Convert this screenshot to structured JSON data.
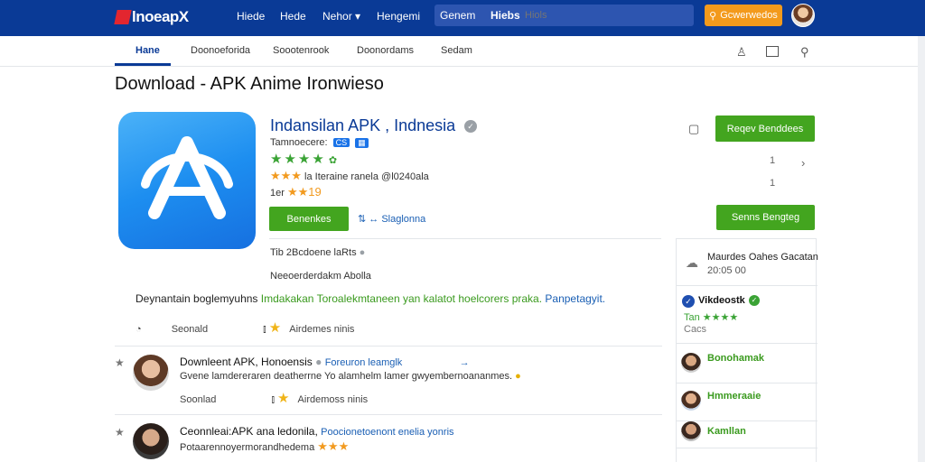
{
  "topbar": {
    "logo": "lnoeapX",
    "nav": [
      "Hiede",
      "Hede",
      "Nehor"
    ],
    "search_left": "Hengemi",
    "search_a": "Genem",
    "search_b": "Hiebs",
    "search_placeholder": "Hiols",
    "action_button": "Gcwerwedos"
  },
  "subnav": {
    "tabs": [
      "Hane",
      "Doonoeforida",
      "Soootenrook",
      "Doonordams",
      "Sedam"
    ]
  },
  "page_title": "Download - APK Anime Ironwieso",
  "app": {
    "name": "Indansilan APK , Indnesia",
    "developer": "Tamnoecere:",
    "developer_chip": "CS",
    "rating_stars": "★★★★",
    "rating_text": "la Iteraine ranela @l0240ala",
    "rating_prefix": "★★★",
    "size_label": "1er",
    "size_stars": "★★19",
    "download_button": "Benenkes",
    "share_label": "Slaglonna",
    "info_line": "Tib 2Bcdoene laRts",
    "info_line2": "Neeoerderdakm Abolla"
  },
  "description": {
    "part1": "Deynantain boglemyuhns",
    "part2": "Imdakakan Toroalekmtaneen yan kalatot hoelcorers praka.",
    "part3": "Panpetagyit."
  },
  "actions": {
    "left": "Seonald",
    "rating": "Airdemes ninis"
  },
  "reviews": [
    {
      "title": "Downleent APK, Honoensis",
      "tag": "Foreuron leamglk",
      "text": "Gvene lamdereraren deatherrne Yo alamhelm lamer gwyembernoananmes.",
      "left": "Soonlad",
      "rating": "Airdemoss ninis"
    },
    {
      "title": "Ceonnleai:APK ana ledonila,",
      "tag": "Poocionetoenont enelia yonris",
      "text": "Potaarennoyermorandhedema",
      "stars": "★★★"
    }
  ],
  "sidebar": {
    "primary_button": "Reqev Benddees",
    "secondary_button": "Senns Bengteg",
    "nav_top": "1",
    "nav_bottom": "1",
    "info_title": "Maurdes Oahes Gacatan",
    "info_sub": "20:05 00",
    "verified_name": "Vikdeostk",
    "verified_rating": "Tan ★★★★",
    "verified_sub": "Cacs",
    "users": [
      "Bonohamak",
      "Hmmeraaie",
      "Kamllan"
    ]
  },
  "colors": {
    "topbar": "#0a3a96",
    "accent_orange": "#f39a1c",
    "accent_green": "#43a51f",
    "link_blue": "#1a5fb4"
  }
}
